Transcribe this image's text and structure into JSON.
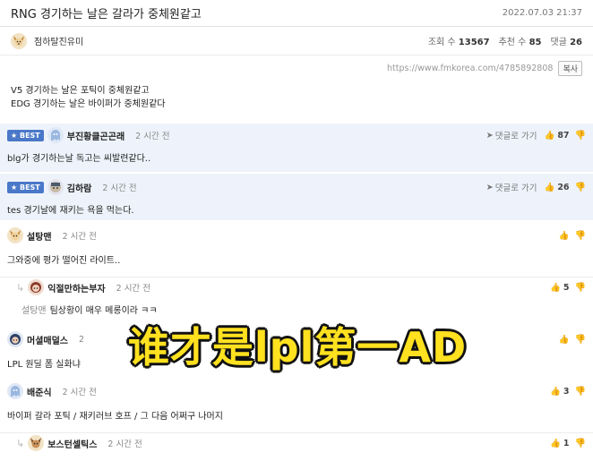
{
  "post": {
    "title": "RNG 경기하는 날은 갈라가 중체원같고",
    "date": "2022.07.03 21:37",
    "author": "점하탈진유미",
    "views_label": "조회 수",
    "views": "13567",
    "recommend_label": "추천 수",
    "recommend": "85",
    "comments_label": "댓글",
    "comments": "26",
    "url": "https://www.fmkorea.com/4785892808",
    "copy_label": "복사",
    "body": [
      "V5 경기하는 날은 포틱이 중체원같고",
      "EDG 경기하는 날은 바이퍼가 중체원같다"
    ]
  },
  "comments": [
    {
      "best": "BEST",
      "nick": "부진황클곤곤래",
      "time": "2 시간 전",
      "reply": "댓글로 가기",
      "likes": "87",
      "text": "blg가 경기하는날 독고는 씨발련같다.."
    },
    {
      "best": "BEST",
      "nick": "김하람",
      "time": "2 시간 전",
      "reply": "댓글로 가기",
      "likes": "26",
      "text": "tes 경기날에 재키는 욕을 먹는다."
    },
    {
      "nick": "설탕맨",
      "time": "2 시간 전",
      "text": "그와중에 평가 떨어진 라이트.."
    },
    {
      "nick": "익절만하는부자",
      "time": "2 시간 전",
      "likes": "5",
      "mention": "설탕맨",
      "text": "팀상황이 매우 메롱이라 ㅋㅋ"
    },
    {
      "nick": "머셜매덜스",
      "time": "2",
      "text": "LPL 원딜 폼 실화냐"
    },
    {
      "nick": "배준식",
      "time": "2 시간 전",
      "likes": "3",
      "text": "바이퍼 갈라 포틱 / 재키러브 호프 / 그 다음 어쩌구 나머지"
    },
    {
      "nick": "보스턴셀틱스",
      "time": "2 시간 전",
      "likes": "1"
    }
  ],
  "overlay_caption": "谁才是lpl第一AD",
  "colors": {
    "best_bg": "#eef3fb",
    "best_badge": "#4a78c9",
    "overlay": "#ffe11f"
  }
}
